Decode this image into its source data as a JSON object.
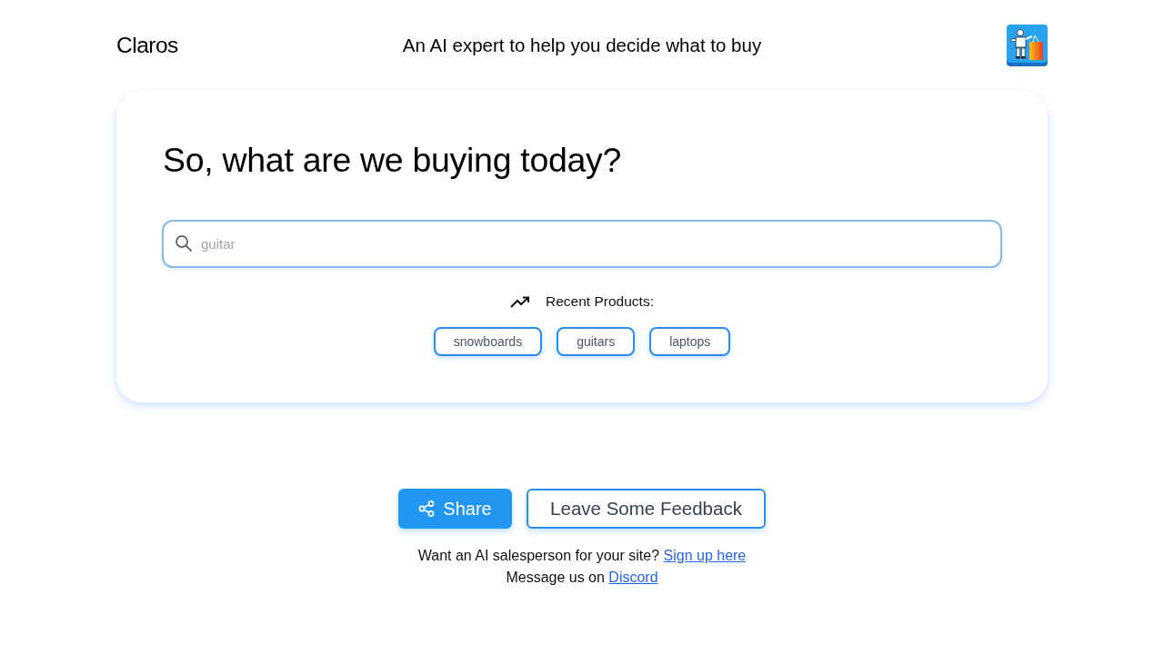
{
  "header": {
    "brand": "Claros",
    "tagline": "An AI expert to help you decide what to buy"
  },
  "card": {
    "heading": "So, what are we buying today?",
    "search": {
      "placeholder": "guitar"
    },
    "recent_label": "Recent Products:",
    "recent_products": [
      "snowboards",
      "guitars",
      "laptops"
    ]
  },
  "actions": [
    {
      "kind": "primary",
      "label": "Share"
    },
    {
      "kind": "outline",
      "label": "Leave Some Feedback"
    }
  ],
  "footer": [
    {
      "text": "Want an AI salesperson for your site?",
      "link": "Sign up here"
    },
    {
      "text": "Message us on",
      "link": "Discord"
    }
  ]
}
